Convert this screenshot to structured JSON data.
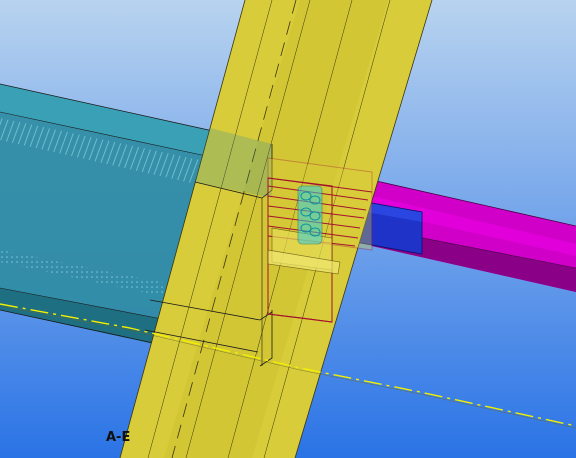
{
  "viewport": {
    "background_top": "#b8d3ef",
    "background_bottom": "#2a73e6"
  },
  "colors": {
    "teal_beam": "#2f8ca3",
    "teal_beam_dark": "#1f6f82",
    "teal_hatch": "#6fc4d0",
    "yellow_column": "#d8cc3a",
    "yellow_column_dark": "#b5a92a",
    "magenta_beam": "#d000c8",
    "magenta_beam_dark": "#8a0086",
    "connection_plate": "#1f33c9",
    "plate_outline": "#a5122e",
    "bolts": "#30d0e0",
    "gridline": "#f2f000",
    "edges": "#1a1a1a"
  },
  "labels": {
    "gridline_label": "A-E"
  }
}
